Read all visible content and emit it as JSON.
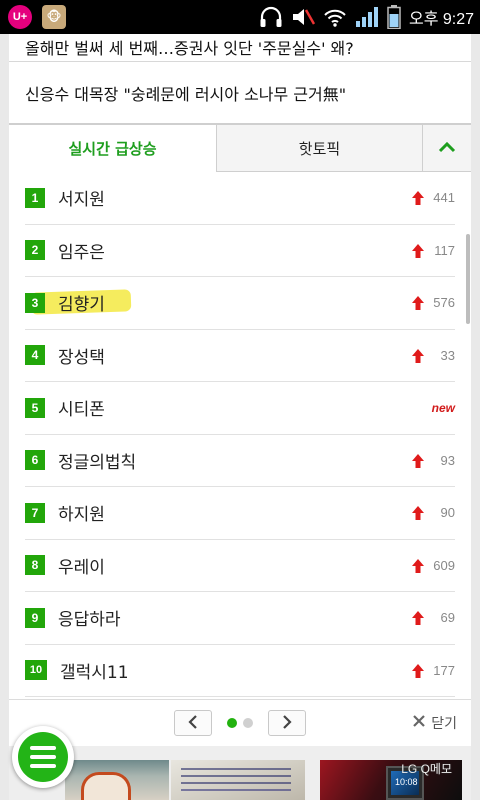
{
  "status_bar": {
    "carrier_badge": "U+",
    "time": "오후 9:27",
    "icons": [
      "headphones-icon",
      "mute-icon",
      "wifi-icon",
      "signal-icon",
      "battery-icon"
    ]
  },
  "headlines": [
    "올해만 벌써 세 번째…증권사 잇단 '주문실수' 왜?",
    "신응수 대목장 \"숭례문에 러시아 소나무 근거無\""
  ],
  "tabs": {
    "realtime": "실시간 급상승",
    "hot_topic": "핫토픽",
    "active": "realtime"
  },
  "ranking": [
    {
      "rank": "1",
      "name": "서지원",
      "change": "441",
      "trend": "up"
    },
    {
      "rank": "2",
      "name": "임주은",
      "change": "117",
      "trend": "up"
    },
    {
      "rank": "3",
      "name": "김향기",
      "change": "576",
      "trend": "up"
    },
    {
      "rank": "4",
      "name": "장성택",
      "change": "33",
      "trend": "up"
    },
    {
      "rank": "5",
      "name": "시티폰",
      "change": "new",
      "trend": "new"
    },
    {
      "rank": "6",
      "name": "정글의법칙",
      "change": "93",
      "trend": "up"
    },
    {
      "rank": "7",
      "name": "하지원",
      "change": "90",
      "trend": "up"
    },
    {
      "rank": "8",
      "name": "우레이",
      "change": "609",
      "trend": "up"
    },
    {
      "rank": "9",
      "name": "응답하라",
      "change": "69",
      "trend": "up"
    },
    {
      "rank": "10",
      "name": "갤럭시11",
      "change": "177",
      "trend": "up"
    }
  ],
  "pager": {
    "current_page": 1,
    "total_pages": 2,
    "close_label": "닫기"
  },
  "thumbnails": {
    "third_watermark": "LG Q메모",
    "third_time": "10:08"
  },
  "colors": {
    "accent_green": "#22a60a",
    "up_arrow_red": "#e01b1b",
    "new_red": "#d21b1b",
    "status_bar_bg": "#000000"
  }
}
